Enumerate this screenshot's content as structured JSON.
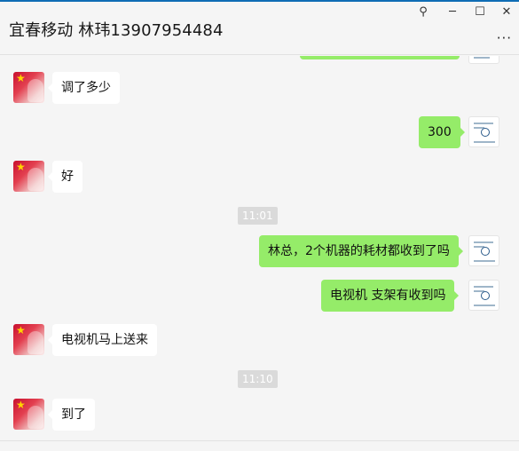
{
  "window": {
    "title": "宜春移动 林玮13907954484",
    "pin_glyph": "⚲",
    "minimize_glyph": "─",
    "maximize_glyph": "☐",
    "close_glyph": "✕",
    "more_glyph": "···"
  },
  "messages": [
    {
      "side": "in",
      "text": "调了多少"
    },
    {
      "side": "out",
      "text": "300"
    },
    {
      "side": "in",
      "text": "好"
    },
    {
      "type": "time",
      "text": "11:01"
    },
    {
      "side": "out",
      "text": "林总，2个机器的耗材都收到了吗"
    },
    {
      "side": "out",
      "text": "电视机  支架有收到吗"
    },
    {
      "side": "in",
      "text": "电视机马上送来"
    },
    {
      "type": "time",
      "text": "11:10"
    },
    {
      "side": "in",
      "text": "到了"
    }
  ],
  "avatars": {
    "contact_icon": "flag-portrait-avatar",
    "self_icon": "document-thumbnail-avatar"
  },
  "colors": {
    "outgoing_bubble": "#95ec69",
    "incoming_bubble": "#ffffff",
    "background": "#f5f5f5",
    "timestamp_bg": "#dadada"
  }
}
